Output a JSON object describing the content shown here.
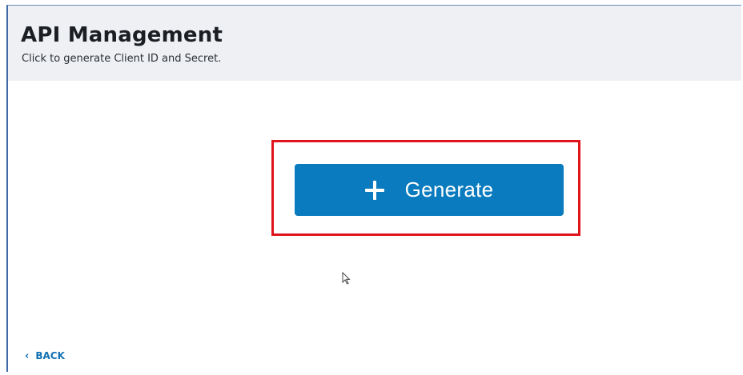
{
  "header": {
    "title": "API Management",
    "subtitle": "Click to generate Client ID and Secret."
  },
  "actions": {
    "generate_label": "Generate",
    "generate_icon": "plus-icon"
  },
  "footer": {
    "back_label": "BACK",
    "back_icon": "chevron-left-icon"
  },
  "colors": {
    "primary": "#0a7bbf",
    "highlight": "#e0141b",
    "header_bg": "#eef0f3",
    "link": "#1271b3"
  }
}
